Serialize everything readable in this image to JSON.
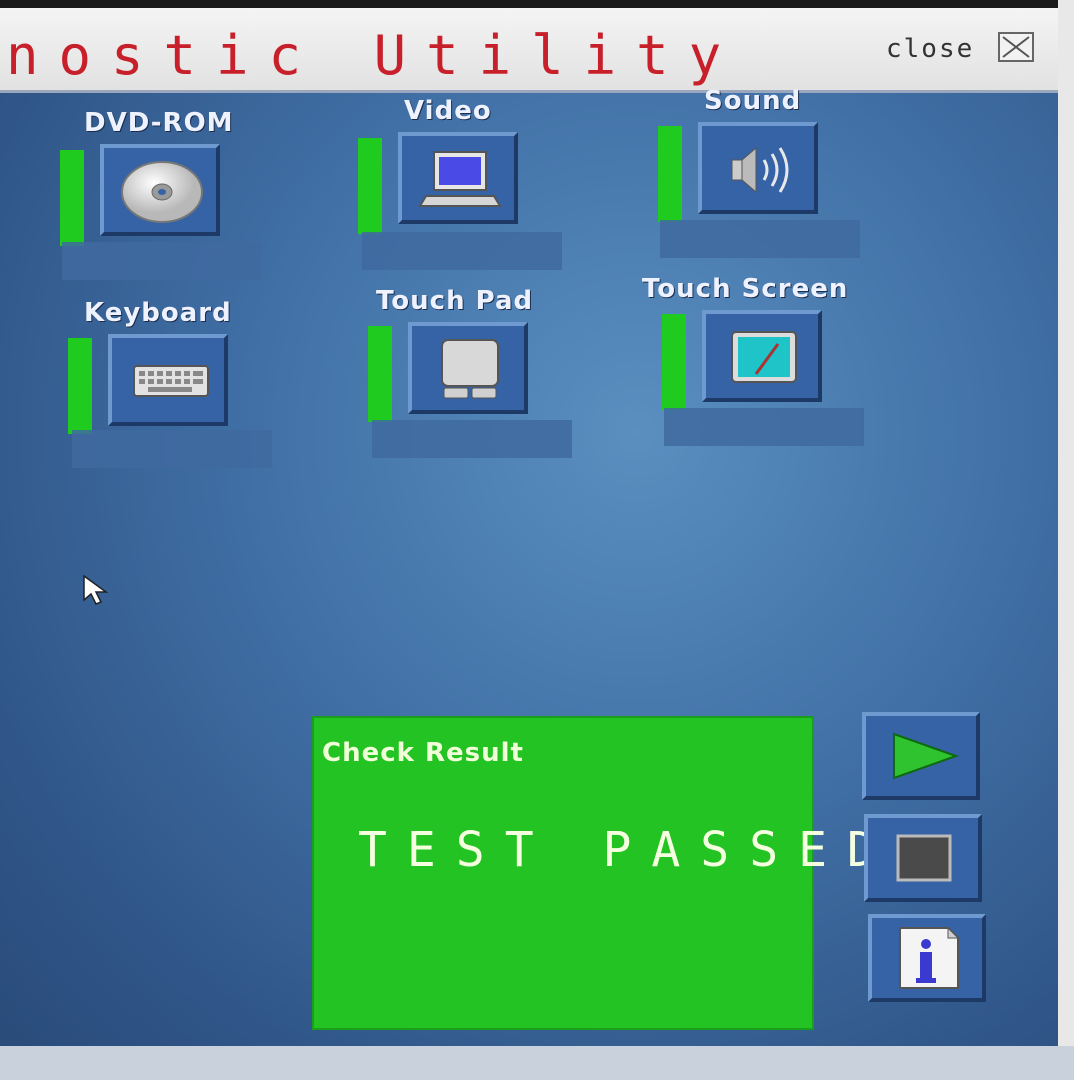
{
  "window": {
    "title": "nostic Utility",
    "close_label": "close"
  },
  "devices": [
    {
      "label": "DVD-ROM",
      "icon": "disc-icon",
      "status_color": "#1ecb1e"
    },
    {
      "label": "Video",
      "icon": "laptop-icon",
      "status_color": "#1ecb1e"
    },
    {
      "label": "Sound",
      "icon": "speaker-icon",
      "status_color": "#1ecb1e"
    },
    {
      "label": "Keyboard",
      "icon": "keyboard-icon",
      "status_color": "#1ecb1e"
    },
    {
      "label": "Touch Pad",
      "icon": "touchpad-icon",
      "status_color": "#1ecb1e"
    },
    {
      "label": "Touch Screen",
      "icon": "touchscreen-icon",
      "status_color": "#1ecb1e"
    }
  ],
  "result": {
    "title": "Check Result",
    "message": "TEST PASSED",
    "color": "#22c322"
  },
  "controls": [
    {
      "name": "play-button",
      "icon": "play-icon"
    },
    {
      "name": "stop-button",
      "icon": "stop-icon"
    },
    {
      "name": "info-button",
      "icon": "info-icon"
    }
  ],
  "colors": {
    "accent": "#c8202a",
    "pass": "#22c322",
    "panel": "#3563a6"
  }
}
